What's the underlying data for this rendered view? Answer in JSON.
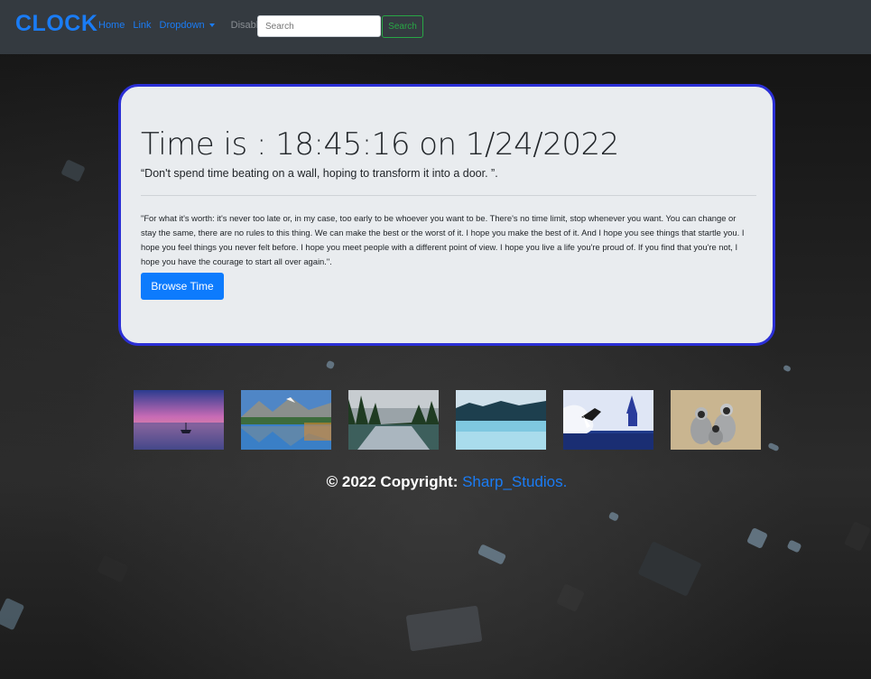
{
  "navbar": {
    "brand": "CLOCK",
    "links": [
      "Home",
      "Link",
      "Dropdown",
      "Disabled"
    ],
    "search_placeholder": "Search",
    "search_button": "Search"
  },
  "card": {
    "time": "Time is : 18:45:16 on 1/24/2022",
    "quote_short": "“Don't spend time beating on a wall, hoping to transform it into a door. ”.",
    "quote_long": "\"For what it's worth: it's never too late or, in my case, too early to be whoever you want to be. There's no time limit, stop whenever you want. You can change or stay the same, there are no rules to this thing. We can make the best or the worst of it. I hope you make the best of it. And I hope you see things that startle you. I hope you feel things you never felt before. I hope you meet people with a different point of view. I hope you live a life you're proud of. If you find that you're not, I hope you have the courage to start all over again.\".",
    "browse_button": "Browse Time"
  },
  "footer": {
    "copyright": "© 2022 Copyright: ",
    "link": "Sharp_Studios."
  },
  "colors": {
    "accent": "#1a7cf5",
    "card_border": "#2b2fd6",
    "search_green": "#28a745"
  },
  "gallery": [
    {
      "name": "sunset-lake-boat-image"
    },
    {
      "name": "mountain-lake-image"
    },
    {
      "name": "forest-river-image"
    },
    {
      "name": "misty-lake-image"
    },
    {
      "name": "snowy-bird-image"
    },
    {
      "name": "monkeys-image"
    }
  ]
}
